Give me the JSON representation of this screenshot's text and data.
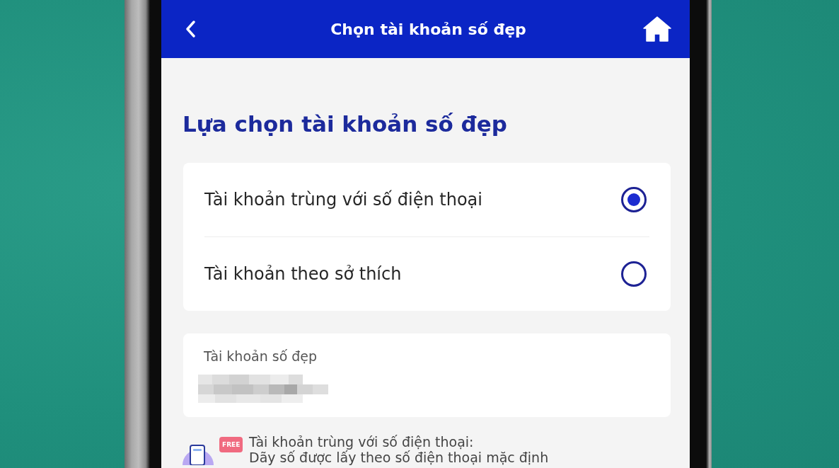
{
  "header": {
    "title": "Chọn tài khoản số đẹp"
  },
  "heading": "Lựa chọn tài khoản số đẹp",
  "account_options": [
    {
      "label": "Tài khoản trùng với số điện thoại",
      "selected": true
    },
    {
      "label": "Tài khoản theo sở thích",
      "selected": false
    }
  ],
  "account_field": {
    "label": "Tài khoản số đẹp",
    "value_blurred": true
  },
  "note": {
    "badge": "FREE",
    "title": "Tài khoản trùng với số điện thoại:",
    "text": "Dãy số được lấy theo số điện thoại mặc định"
  }
}
